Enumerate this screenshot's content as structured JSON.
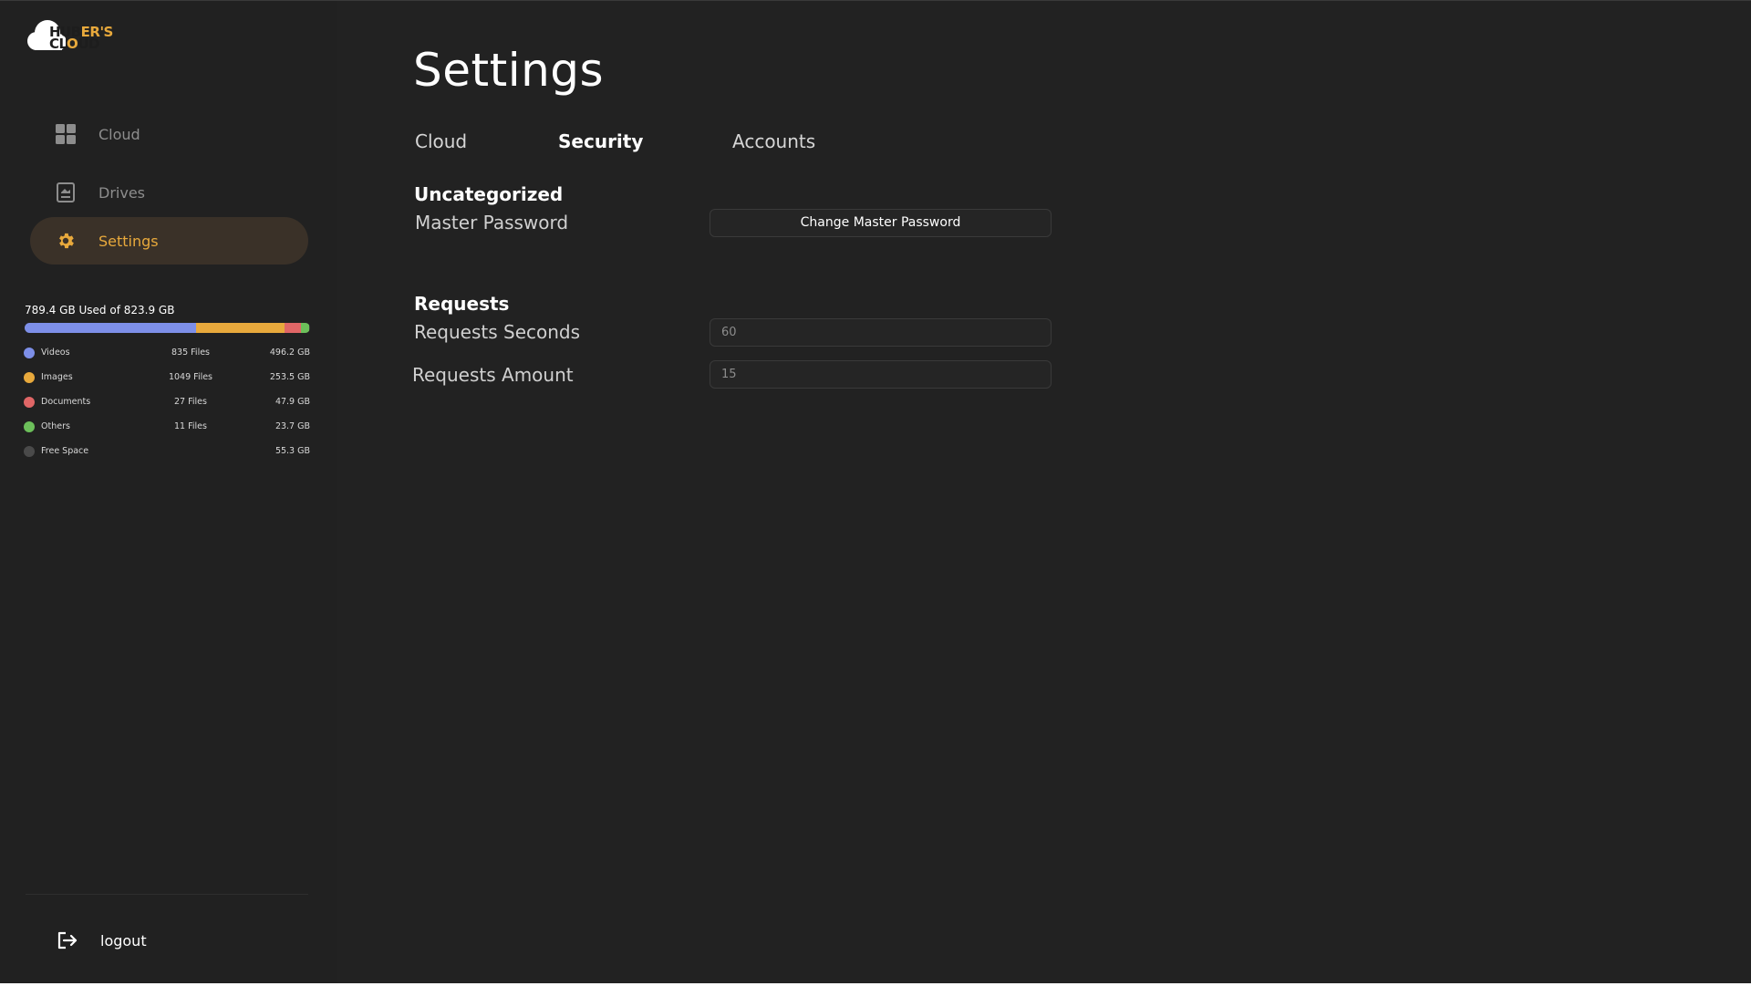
{
  "app": {
    "logo_text_line1": "HUBER'S",
    "logo_text_line2": "CLOUD",
    "accent_color": "#e8a93c"
  },
  "sidebar": {
    "items": [
      {
        "label": "Cloud",
        "icon": "grid-icon",
        "active": false
      },
      {
        "label": "Drives",
        "icon": "drive-icon",
        "active": false
      },
      {
        "label": "Settings",
        "icon": "gear-icon",
        "active": true
      }
    ],
    "storage": {
      "summary": "789.4 GB Used of 823.9 GB",
      "used_fraction": 0.958,
      "categories": [
        {
          "name": "Videos",
          "files": "835 Files",
          "size": "496.2 GB",
          "color": "#7d8fe8",
          "fraction": 0.602
        },
        {
          "name": "Images",
          "files": "1049 Files",
          "size": "253.5 GB",
          "color": "#e8a93c",
          "fraction": 0.308
        },
        {
          "name": "Documents",
          "files": "27 Files",
          "size": "47.9 GB",
          "color": "#e06666",
          "fraction": 0.058
        },
        {
          "name": "Others",
          "files": "11 Files",
          "size": "23.7 GB",
          "color": "#6cbf5a",
          "fraction": 0.029
        },
        {
          "name": "Free Space",
          "files": "",
          "size": "55.3 GB",
          "color": "#4a4a4a",
          "fraction": 0.067
        }
      ]
    },
    "logout_label": "logout"
  },
  "main": {
    "title": "Settings",
    "tabs": [
      {
        "label": "Cloud",
        "active": false
      },
      {
        "label": "Security",
        "active": true
      },
      {
        "label": "Accounts",
        "active": false
      }
    ],
    "sections": {
      "uncategorized": {
        "title": "Uncategorized",
        "master_password_label": "Master Password",
        "change_button_label": "Change Master Password"
      },
      "requests": {
        "title": "Requests",
        "seconds_label": "Requests Seconds",
        "seconds_placeholder": "60",
        "amount_label": "Requests Amount",
        "amount_placeholder": "15"
      }
    }
  }
}
